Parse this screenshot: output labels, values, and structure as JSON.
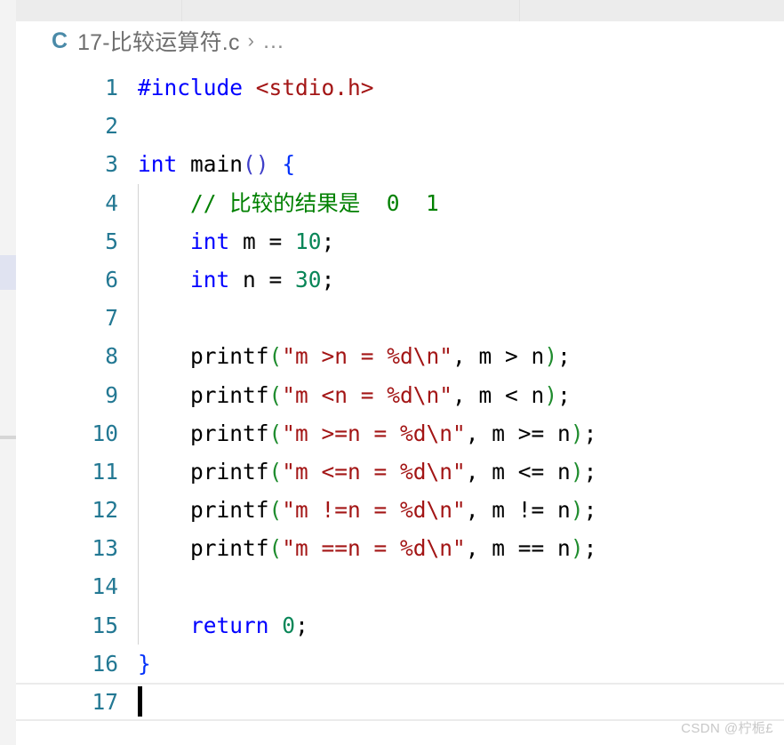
{
  "window": {
    "background": "#ffffff",
    "tabstrip_color": "#ececec",
    "rail_color": "#f3f3f3",
    "rail_highlight_color": "#e0e3f1"
  },
  "tabs": [
    {
      "label": ""
    },
    {
      "label": ""
    },
    {
      "label": ""
    }
  ],
  "breadcrumb": {
    "file_icon_letter": "C",
    "file_name": "17-比较运算符.c",
    "separator": "›",
    "more": "…"
  },
  "editor": {
    "language": "c",
    "cursor_line": 17,
    "cursor_column": 1,
    "colors": {
      "line_number": "#237893",
      "preprocessor": "#0000ff",
      "keyword": "#0000ff",
      "string": "#a31515",
      "comment": "#008000",
      "number": "#098658",
      "bracket_green": "#1f8c2e",
      "bracket_blue": "#0431fa",
      "active_line_border": "#ebebeb",
      "indent_guide": "#d3d3d3"
    },
    "lines": [
      {
        "number": "1",
        "indent_guide": false,
        "active": false,
        "tokens": [
          {
            "text": "#include ",
            "cls": "t-pre"
          },
          {
            "text": "<stdio.h>",
            "cls": "t-hdr"
          }
        ]
      },
      {
        "number": "2",
        "indent_guide": false,
        "active": false,
        "tokens": []
      },
      {
        "number": "3",
        "indent_guide": false,
        "active": false,
        "tokens": [
          {
            "text": "int ",
            "cls": "t-kw"
          },
          {
            "text": "main",
            "cls": "t-fn"
          },
          {
            "text": "()",
            "cls": "t-paren1"
          },
          {
            "text": " ",
            "cls": "t-op"
          },
          {
            "text": "{",
            "cls": "t-brace"
          }
        ]
      },
      {
        "number": "4",
        "indent_guide": true,
        "active": false,
        "tokens": [
          {
            "text": "    // 比较的结果是  0  1",
            "cls": "t-cmt"
          }
        ]
      },
      {
        "number": "5",
        "indent_guide": true,
        "active": false,
        "tokens": [
          {
            "text": "    ",
            "cls": "t-op"
          },
          {
            "text": "int",
            "cls": "t-kw"
          },
          {
            "text": " m = ",
            "cls": "t-op"
          },
          {
            "text": "10",
            "cls": "t-num"
          },
          {
            "text": ";",
            "cls": "t-op"
          }
        ]
      },
      {
        "number": "6",
        "indent_guide": true,
        "active": false,
        "tokens": [
          {
            "text": "    ",
            "cls": "t-op"
          },
          {
            "text": "int",
            "cls": "t-kw"
          },
          {
            "text": " n = ",
            "cls": "t-op"
          },
          {
            "text": "30",
            "cls": "t-num"
          },
          {
            "text": ";",
            "cls": "t-op"
          }
        ]
      },
      {
        "number": "7",
        "indent_guide": true,
        "active": false,
        "tokens": []
      },
      {
        "number": "8",
        "indent_guide": true,
        "active": false,
        "tokens": [
          {
            "text": "    printf",
            "cls": "t-fn"
          },
          {
            "text": "(",
            "cls": "t-paren2"
          },
          {
            "text": "\"m >n = %d\\n\"",
            "cls": "t-str"
          },
          {
            "text": ", m > n",
            "cls": "t-op"
          },
          {
            "text": ")",
            "cls": "t-paren2"
          },
          {
            "text": ";",
            "cls": "t-op"
          }
        ]
      },
      {
        "number": "9",
        "indent_guide": true,
        "active": false,
        "tokens": [
          {
            "text": "    printf",
            "cls": "t-fn"
          },
          {
            "text": "(",
            "cls": "t-paren2"
          },
          {
            "text": "\"m <n = %d\\n\"",
            "cls": "t-str"
          },
          {
            "text": ", m < n",
            "cls": "t-op"
          },
          {
            "text": ")",
            "cls": "t-paren2"
          },
          {
            "text": ";",
            "cls": "t-op"
          }
        ]
      },
      {
        "number": "10",
        "indent_guide": true,
        "active": false,
        "tokens": [
          {
            "text": "    printf",
            "cls": "t-fn"
          },
          {
            "text": "(",
            "cls": "t-paren2"
          },
          {
            "text": "\"m >=n = %d\\n\"",
            "cls": "t-str"
          },
          {
            "text": ", m >= n",
            "cls": "t-op"
          },
          {
            "text": ")",
            "cls": "t-paren2"
          },
          {
            "text": ";",
            "cls": "t-op"
          }
        ]
      },
      {
        "number": "11",
        "indent_guide": true,
        "active": false,
        "tokens": [
          {
            "text": "    printf",
            "cls": "t-fn"
          },
          {
            "text": "(",
            "cls": "t-paren2"
          },
          {
            "text": "\"m <=n = %d\\n\"",
            "cls": "t-str"
          },
          {
            "text": ", m <= n",
            "cls": "t-op"
          },
          {
            "text": ")",
            "cls": "t-paren2"
          },
          {
            "text": ";",
            "cls": "t-op"
          }
        ]
      },
      {
        "number": "12",
        "indent_guide": true,
        "active": false,
        "tokens": [
          {
            "text": "    printf",
            "cls": "t-fn"
          },
          {
            "text": "(",
            "cls": "t-paren2"
          },
          {
            "text": "\"m !=n = %d\\n\"",
            "cls": "t-str"
          },
          {
            "text": ", m != n",
            "cls": "t-op"
          },
          {
            "text": ")",
            "cls": "t-paren2"
          },
          {
            "text": ";",
            "cls": "t-op"
          }
        ]
      },
      {
        "number": "13",
        "indent_guide": true,
        "active": false,
        "tokens": [
          {
            "text": "    printf",
            "cls": "t-fn"
          },
          {
            "text": "(",
            "cls": "t-paren2"
          },
          {
            "text": "\"m ==n = %d\\n\"",
            "cls": "t-str"
          },
          {
            "text": ", m == n",
            "cls": "t-op"
          },
          {
            "text": ")",
            "cls": "t-paren2"
          },
          {
            "text": ";",
            "cls": "t-op"
          }
        ]
      },
      {
        "number": "14",
        "indent_guide": true,
        "active": false,
        "tokens": []
      },
      {
        "number": "15",
        "indent_guide": true,
        "active": false,
        "tokens": [
          {
            "text": "    ",
            "cls": "t-op"
          },
          {
            "text": "return",
            "cls": "t-kw"
          },
          {
            "text": " ",
            "cls": "t-op"
          },
          {
            "text": "0",
            "cls": "t-num"
          },
          {
            "text": ";",
            "cls": "t-op"
          }
        ]
      },
      {
        "number": "16",
        "indent_guide": false,
        "active": false,
        "tokens": [
          {
            "text": "}",
            "cls": "t-brace"
          }
        ]
      },
      {
        "number": "17",
        "indent_guide": false,
        "active": true,
        "caret": true,
        "tokens": []
      }
    ]
  },
  "watermark": {
    "text": "CSDN @柠栀£"
  }
}
